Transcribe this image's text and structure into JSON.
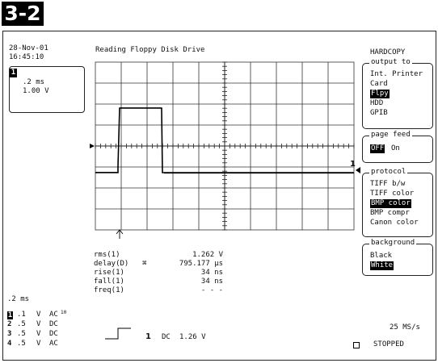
{
  "figure_label": "3-2",
  "datetime": {
    "date": "28-Nov-01",
    "time": "16:45:10"
  },
  "trace_title": "Reading Floppy Disk Drive",
  "trace_box": {
    "channel": "1",
    "timebase": ".2 ms",
    "volts": "1.00 V"
  },
  "menu": {
    "title": "HARDCOPY",
    "output_to": {
      "title": "output to",
      "items": [
        "Int. Printer",
        "Card",
        "Flpy",
        "HDD",
        "GPIB"
      ],
      "selected": "Flpy"
    },
    "page_feed": {
      "title": "page feed",
      "options": [
        "OFF",
        "On"
      ],
      "selected": "OFF"
    },
    "protocol": {
      "title": "protocol",
      "items": [
        "TIFF b/w",
        "TIFF color",
        "BMP color",
        "BMP compr",
        "Canon color"
      ],
      "selected": "BMP color"
    },
    "background": {
      "title": "background",
      "items": [
        "Black",
        "White"
      ],
      "selected": "White"
    }
  },
  "channel_marker": "1",
  "measurements": [
    {
      "label": "rms(1)",
      "flag": "",
      "value": "1.262 V"
    },
    {
      "label": "delay(D)",
      "flag": "⌘",
      "value": "795.177 μs"
    },
    {
      "label": "rise(1)",
      "flag": "",
      "value": "34 ns"
    },
    {
      "label": "fall(1)",
      "flag": "",
      "value": "34 ns"
    },
    {
      "label": "freq(1)",
      "flag": "",
      "value": "- - -"
    }
  ],
  "timebase": ".2 ms",
  "channels": [
    {
      "num": "1",
      "volts": ".1",
      "unit": "V",
      "coupling": "AC",
      "bwl": "10"
    },
    {
      "num": "2",
      "volts": ".5",
      "unit": "V",
      "coupling": "DC",
      "bwl": ""
    },
    {
      "num": "3",
      "volts": ".5",
      "unit": "V",
      "coupling": "DC",
      "bwl": ""
    },
    {
      "num": "4",
      "volts": ".5",
      "unit": "V",
      "coupling": "AC",
      "bwl": ""
    }
  ],
  "trigger": {
    "source": "1",
    "coupling": "DC",
    "level": "1.26 V"
  },
  "sample_rate": "25 MS/s",
  "status": "STOPPED"
}
